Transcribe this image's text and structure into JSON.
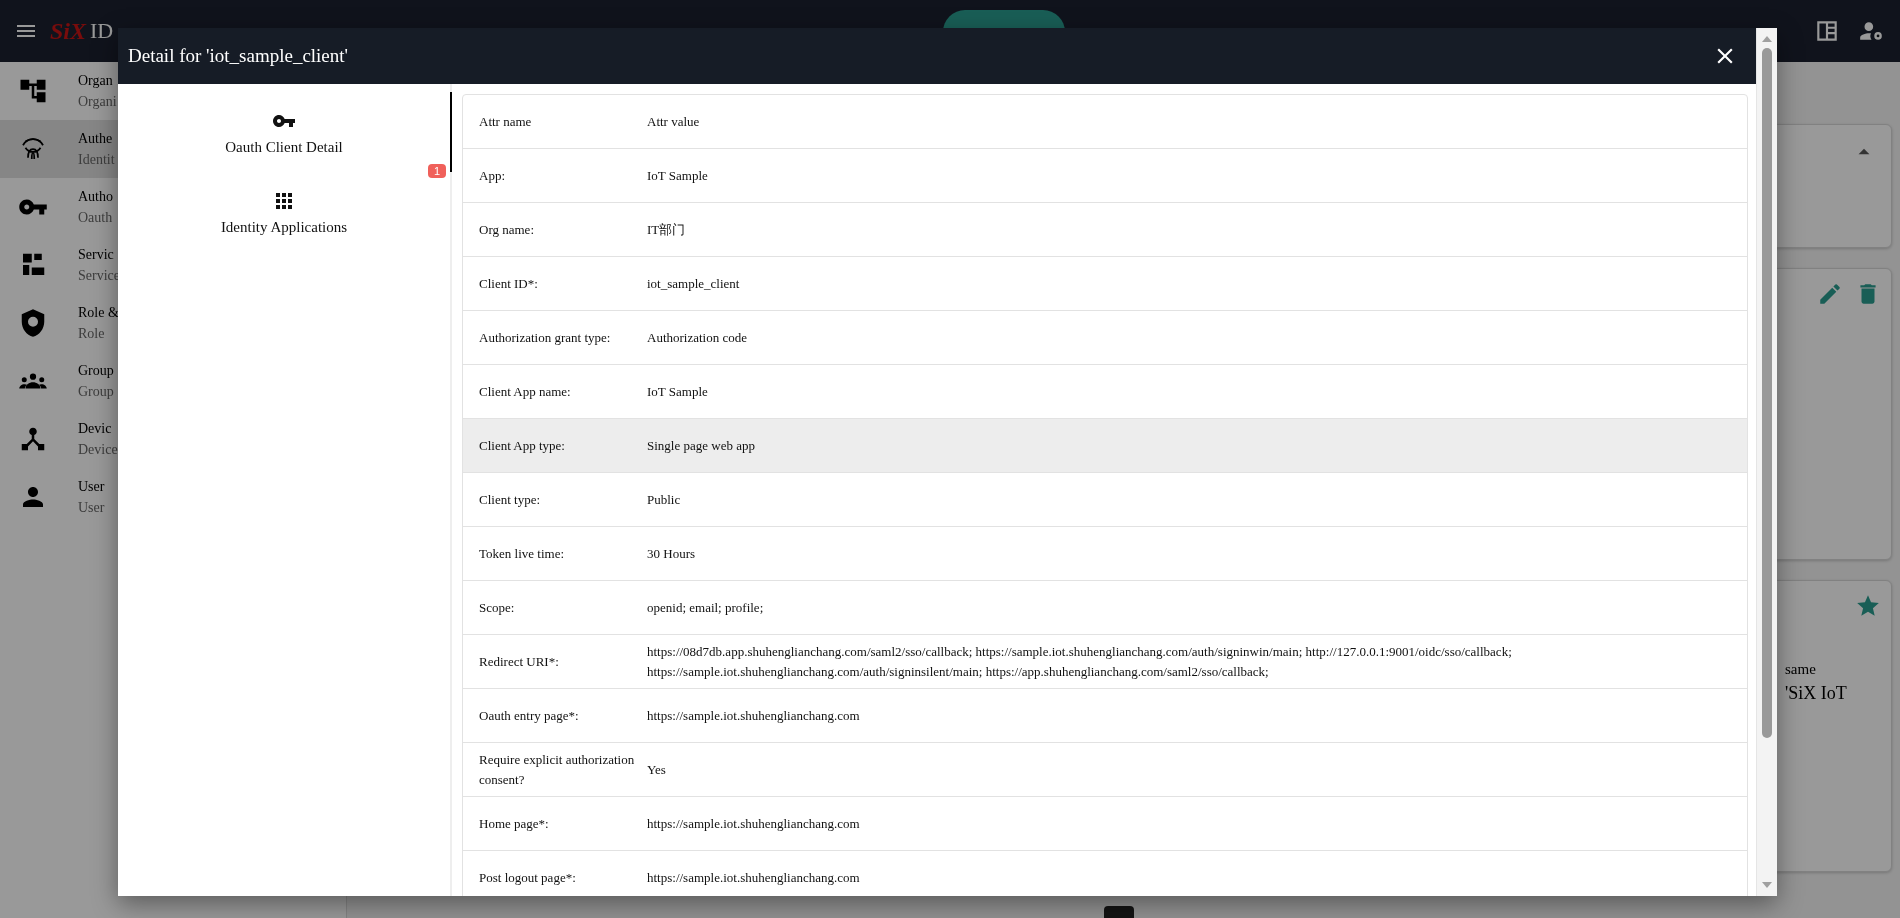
{
  "app_bar": {
    "logo": "SiX",
    "title": "ID"
  },
  "sidebar": {
    "items": [
      {
        "title": "Organ",
        "subtitle": "Organi",
        "selected": false
      },
      {
        "title": "Authe",
        "subtitle": "Identit",
        "selected": true
      },
      {
        "title": "Autho",
        "subtitle": "Oauth",
        "selected": false
      },
      {
        "title": "Servic",
        "subtitle": "Service",
        "selected": false
      },
      {
        "title": "Role &",
        "subtitle": "Role",
        "selected": false
      },
      {
        "title": "Group",
        "subtitle": "Group",
        "selected": false
      },
      {
        "title": "Devic",
        "subtitle": "Device",
        "selected": false
      },
      {
        "title": "User",
        "subtitle": "User",
        "selected": false
      }
    ]
  },
  "background_card": {
    "lines": [
      "same",
      "'SiX IoT"
    ]
  },
  "dialog": {
    "title": "Detail for 'iot_sample_client'",
    "tabs": [
      {
        "label": "Oauth Client Detail",
        "selected": true
      },
      {
        "label": "Identity Applications",
        "selected": false,
        "badge": "1"
      }
    ],
    "table": {
      "columns": [
        "Attr name",
        "Attr value"
      ],
      "rows": [
        {
          "name": "App:",
          "value": "IoT Sample",
          "hovered": false
        },
        {
          "name": "Org name:",
          "value": "IT部门",
          "hovered": false
        },
        {
          "name": "Client ID*:",
          "value": "iot_sample_client",
          "hovered": false
        },
        {
          "name": "Authorization grant type:",
          "value": "Authorization code",
          "hovered": false
        },
        {
          "name": "Client App name:",
          "value": "IoT Sample",
          "hovered": false
        },
        {
          "name": "Client App type:",
          "value": "Single page web app",
          "hovered": true
        },
        {
          "name": "Client type:",
          "value": "Public",
          "hovered": false
        },
        {
          "name": "Token live time:",
          "value": "30 Hours",
          "hovered": false
        },
        {
          "name": "Scope:",
          "value": "openid; email; profile;",
          "hovered": false
        },
        {
          "name": "Redirect URI*:",
          "value": "https://08d7db.app.shuhenglianchang.com/saml2/sso/callback; https://sample.iot.shuhenglianchang.com/auth/signinwin/main; http://127.0.0.1:9001/oidc/sso/callback; https://sample.iot.shuhenglianchang.com/auth/signinsilent/main; https://app.shuhenglianchang.com/saml2/sso/callback;",
          "hovered": false
        },
        {
          "name": "Oauth entry page*:",
          "value": "https://sample.iot.shuhenglianchang.com",
          "hovered": false
        },
        {
          "name": "Require explicit authorization consent?",
          "value": "Yes",
          "hovered": false
        },
        {
          "name": "Home page*:",
          "value": "https://sample.iot.shuhenglianchang.com",
          "hovered": false
        },
        {
          "name": "Post logout page*:",
          "value": "https://sample.iot.shuhenglianchang.com",
          "hovered": false
        }
      ]
    }
  }
}
